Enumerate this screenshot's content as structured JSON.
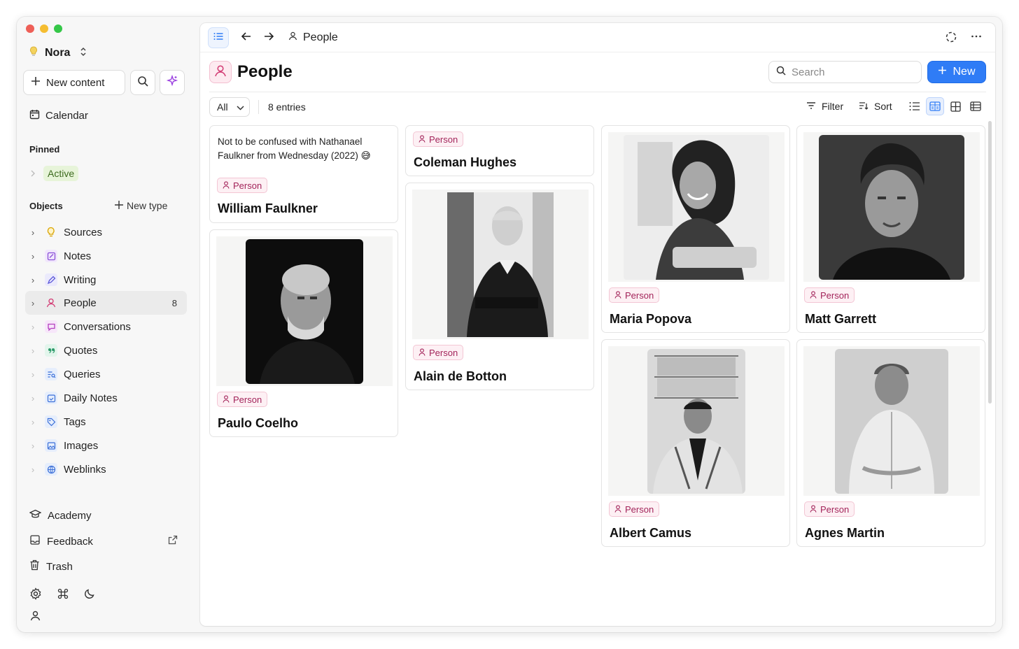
{
  "workspace": {
    "name": "Nora"
  },
  "sidebar": {
    "new_content_label": "New content",
    "calendar_label": "Calendar",
    "pinned_heading": "Pinned",
    "pinned_items": [
      {
        "label": "Active"
      }
    ],
    "objects_heading": "Objects",
    "new_type_label": "New type",
    "objects": [
      {
        "label": "Sources",
        "icon": "bulb-icon",
        "color": "#d9a400"
      },
      {
        "label": "Notes",
        "icon": "note-icon",
        "color": "#8a4fd8"
      },
      {
        "label": "Writing",
        "icon": "pen-icon",
        "color": "#5b57d9"
      },
      {
        "label": "People",
        "icon": "person-icon",
        "color": "#d23a73",
        "count": "8"
      },
      {
        "label": "Conversations",
        "icon": "chat-icon",
        "color": "#b43fbf"
      },
      {
        "label": "Quotes",
        "icon": "quote-icon",
        "color": "#2d9a6a"
      },
      {
        "label": "Queries",
        "icon": "query-icon",
        "color": "#3a6fd8"
      },
      {
        "label": "Daily Notes",
        "icon": "calendar-check-icon",
        "color": "#3a6fd8"
      },
      {
        "label": "Tags",
        "icon": "tag-icon",
        "color": "#3a6fd8"
      },
      {
        "label": "Images",
        "icon": "image-icon",
        "color": "#3a6fd8"
      },
      {
        "label": "Weblinks",
        "icon": "globe-icon",
        "color": "#3a6fd8"
      }
    ],
    "academy_label": "Academy",
    "feedback_label": "Feedback",
    "trash_label": "Trash"
  },
  "toolbar": {
    "breadcrumb": "People"
  },
  "page": {
    "title": "People",
    "search_placeholder": "Search",
    "new_button_label": "New",
    "filter_select": "All",
    "entries_count": "8 entries",
    "filter_label": "Filter",
    "sort_label": "Sort",
    "accent_color": "#2f7cf6",
    "type_color": "#a3245a"
  },
  "cards": [
    {
      "name": "William Faulkner",
      "type": "Person",
      "description": "Not to be confused with Nathanael Faulkner from Wednesday (2022) 😅"
    },
    {
      "name": "Paulo Coelho",
      "type": "Person"
    },
    {
      "name": "Coleman Hughes",
      "type": "Person"
    },
    {
      "name": "Alain de Botton",
      "type": "Person"
    },
    {
      "name": "Maria Popova",
      "type": "Person"
    },
    {
      "name": "Albert Camus",
      "type": "Person"
    },
    {
      "name": "Matt Garrett",
      "type": "Person"
    },
    {
      "name": "Agnes Martin",
      "type": "Person"
    }
  ]
}
